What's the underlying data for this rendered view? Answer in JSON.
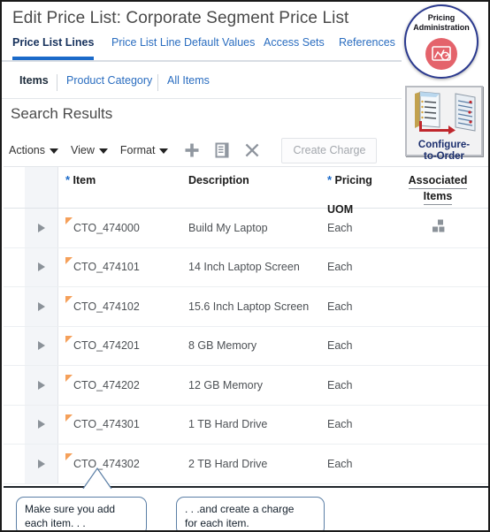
{
  "header": {
    "title": "Edit Price List: Corporate Segment Price List"
  },
  "main_tabs": [
    {
      "label": "Price List Lines",
      "active": true
    },
    {
      "label": "Price List Line Default Values",
      "active": false
    },
    {
      "label": "Access Sets",
      "active": false
    },
    {
      "label": "References",
      "active": false
    }
  ],
  "sub_tabs": [
    {
      "label": "Items",
      "active": true
    },
    {
      "label": "Product Category",
      "active": false
    },
    {
      "label": "All Items",
      "active": false
    }
  ],
  "section": {
    "title": "Search Results"
  },
  "toolbar": {
    "menus": [
      {
        "label": "Actions",
        "icon": "chevron-down-icon"
      },
      {
        "label": "View",
        "icon": "chevron-down-icon"
      },
      {
        "label": "Format",
        "icon": "chevron-down-icon"
      }
    ],
    "icons": [
      {
        "name": "plus-icon",
        "glyph": "+"
      },
      {
        "name": "duplicate-row-icon",
        "glyph": "document"
      },
      {
        "name": "delete-x-icon",
        "glyph": "x"
      }
    ],
    "create_charge_label": "Create Charge",
    "create_charge_disabled": true
  },
  "table": {
    "columns": [
      {
        "label": "Item",
        "required": true
      },
      {
        "label": "Description",
        "required": false
      },
      {
        "label": "Pricing UOM",
        "required": true
      },
      {
        "label": "Associated Items",
        "required": false,
        "sortable_underline": true
      }
    ],
    "pricing_uom_line1": "Pricing",
    "pricing_uom_line2": "UOM",
    "associated_line1": "Associated",
    "associated_line2": "Items",
    "rows": [
      {
        "item": "CTO_474000",
        "description": "Build My Laptop",
        "uom": "Each",
        "associated_icon": "blocks-icon",
        "changed": true
      },
      {
        "item": "CTO_474101",
        "description": "14 Inch Laptop Screen",
        "uom": "Each",
        "associated_icon": "",
        "changed": true
      },
      {
        "item": "CTO_474102",
        "description": "15.6 Inch Laptop Screen",
        "uom": "Each",
        "associated_icon": "",
        "changed": true
      },
      {
        "item": "CTO_474201",
        "description": "8 GB Memory",
        "uom": "Each",
        "associated_icon": "",
        "changed": true
      },
      {
        "item": "CTO_474202",
        "description": "12 GB Memory",
        "uom": "Each",
        "associated_icon": "",
        "changed": true
      },
      {
        "item": "CTO_474301",
        "description": "1 TB Hard Drive",
        "uom": "Each",
        "associated_icon": "",
        "changed": true
      },
      {
        "item": "CTO_474302",
        "description": "2 TB Hard Drive",
        "uom": "Each",
        "associated_icon": "",
        "changed": true
      }
    ]
  },
  "badges": {
    "pricing_admin_line1": "Pricing",
    "pricing_admin_line2": "Administration",
    "cto_line1": "Configure-",
    "cto_line2": "to-Order"
  },
  "callouts": [
    {
      "line1": "Make sure you add",
      "line2": "each item. . ."
    },
    {
      "line1": ". . .and create a charge",
      "line2": "for each item."
    }
  ],
  "colors": {
    "tab_link": "#2a6dc0",
    "tab_active_text": "#16315c",
    "tab_active_underline": "#1b6ac9",
    "required_star": "#1b6ac9",
    "changed_flag": "#f5a05a",
    "badge_ring": "#2b3a8f",
    "badge_disc": "#e4636b",
    "callout_border": "#5b7fa6",
    "frame": "#1a1a1a"
  }
}
